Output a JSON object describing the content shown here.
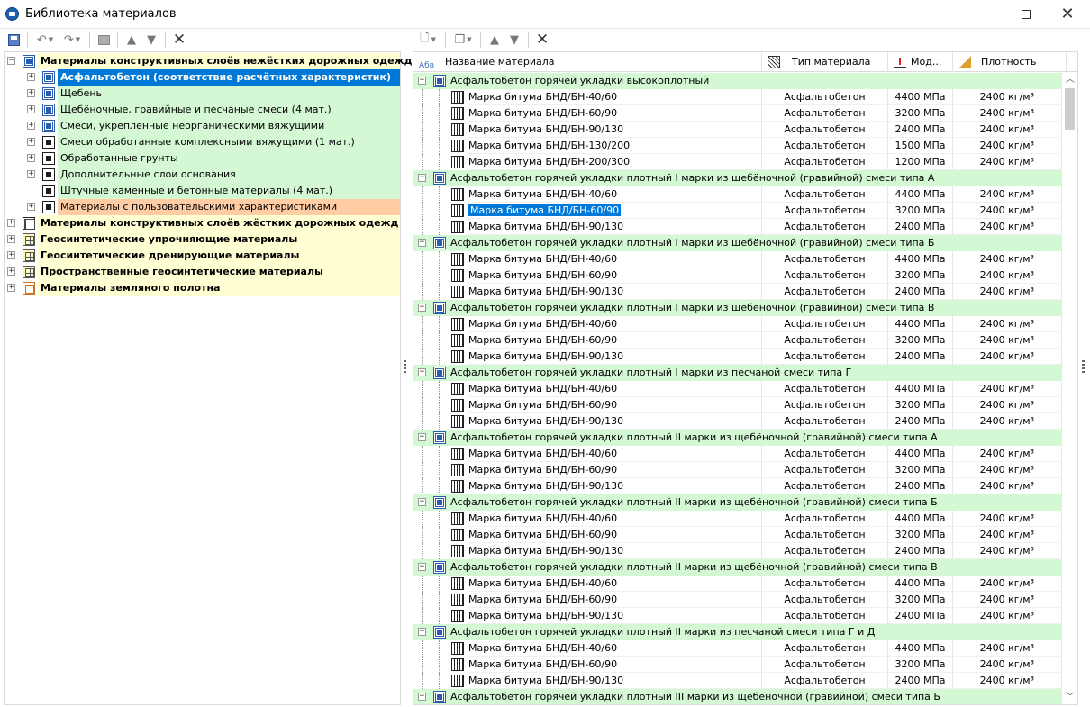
{
  "window": {
    "title": "Библиотека материалов"
  },
  "left_tree": [
    {
      "label": "Материалы конструктивных слоёв нежёстких дорожных одежд",
      "level": 0,
      "bold": true,
      "expanded": true,
      "icon": "blue-square-icon",
      "bg": "yellow"
    },
    {
      "label": "Асфальтобетон (соответствие расчётных характеристик)",
      "level": 1,
      "bold": true,
      "expanded": false,
      "selected": true,
      "icon": "blue-square-icon",
      "bg": "sel"
    },
    {
      "label": "Щебень",
      "level": 1,
      "icon": "blue-square-icon",
      "bg": "green"
    },
    {
      "label": "Щебёночные, гравийные и песчаные смеси (4 мат.)",
      "level": 1,
      "icon": "blue-square-icon",
      "bg": "green"
    },
    {
      "label": "Смеси, укреплённые неорганическими вяжущими",
      "level": 1,
      "icon": "blue-square-icon",
      "bg": "green"
    },
    {
      "label": "Смеси обработанные комплексными вяжущими (1 мат.)",
      "level": 1,
      "icon": "square-icon",
      "bg": "green"
    },
    {
      "label": "Обработанные грунты",
      "level": 1,
      "icon": "square-icon",
      "bg": "green"
    },
    {
      "label": "Дополнительные слои основания",
      "level": 1,
      "icon": "square-icon",
      "bg": "green"
    },
    {
      "label": "Штучные каменные и бетонные материалы (4 мат.)",
      "level": 1,
      "icon": "square-icon",
      "bg": "green",
      "noexp": true
    },
    {
      "label": "Материалы с пользовательскими характеристиками",
      "level": 1,
      "icon": "square-icon",
      "bg": "orange"
    },
    {
      "label": "Материалы конструктивных слоёв жёстких дорожных одежд",
      "level": 0,
      "bold": true,
      "icon": "grid-square-icon",
      "bg": "yellow"
    },
    {
      "label": "Геосинтетические упрочняющие материалы",
      "level": 0,
      "bold": true,
      "icon": "geogrid-icon",
      "bg": "yellow"
    },
    {
      "label": "Геосинтетические дренирующие материалы",
      "level": 0,
      "bold": true,
      "icon": "geogrid-icon",
      "bg": "yellow"
    },
    {
      "label": "Пространственные геосинтетические материалы",
      "level": 0,
      "bold": true,
      "icon": "geogrid-icon",
      "bg": "yellow"
    },
    {
      "label": "Материалы земляного полотна",
      "level": 0,
      "bold": true,
      "icon": "orange-square-icon",
      "bg": "yellow"
    }
  ],
  "grid": {
    "headers": {
      "name": "Название материала",
      "type": "Тип материала",
      "modulus": "Мод...",
      "density": "Плотность"
    },
    "rows": [
      {
        "g": "Асфальтобетон горячей укладки высокоплотный"
      },
      {
        "n": "Марка битума БНД/БН-40/60",
        "t": "Асфальтобетон",
        "m": "4400 МПа",
        "d": "2400 кг/м³"
      },
      {
        "n": "Марка битума БНД/БН-60/90",
        "t": "Асфальтобетон",
        "m": "3200 МПа",
        "d": "2400 кг/м³"
      },
      {
        "n": "Марка битума БНД/БН-90/130",
        "t": "Асфальтобетон",
        "m": "2400 МПа",
        "d": "2400 кг/м³"
      },
      {
        "n": "Марка битума БНД/БН-130/200",
        "t": "Асфальтобетон",
        "m": "1500 МПа",
        "d": "2400 кг/м³"
      },
      {
        "n": "Марка битума БНД/БН-200/300",
        "t": "Асфальтобетон",
        "m": "1200 МПа",
        "d": "2400 кг/м³"
      },
      {
        "g": "Асфальтобетон горячей укладки плотный I марки из щебёночной (гравийной) смеси типа А"
      },
      {
        "n": "Марка битума БНД/БН-40/60",
        "t": "Асфальтобетон",
        "m": "4400 МПа",
        "d": "2400 кг/м³"
      },
      {
        "n": "Марка битума БНД/БН-60/90",
        "t": "Асфальтобетон",
        "m": "3200 МПа",
        "d": "2400 кг/м³",
        "sel": true
      },
      {
        "n": "Марка битума БНД/БН-90/130",
        "t": "Асфальтобетон",
        "m": "2400 МПа",
        "d": "2400 кг/м³"
      },
      {
        "g": "Асфальтобетон горячей укладки плотный I марки из щебёночной (гравийной) смеси типа Б"
      },
      {
        "n": "Марка битума БНД/БН-40/60",
        "t": "Асфальтобетон",
        "m": "4400 МПа",
        "d": "2400 кг/м³"
      },
      {
        "n": "Марка битума БНД/БН-60/90",
        "t": "Асфальтобетон",
        "m": "3200 МПа",
        "d": "2400 кг/м³"
      },
      {
        "n": "Марка битума БНД/БН-90/130",
        "t": "Асфальтобетон",
        "m": "2400 МПа",
        "d": "2400 кг/м³"
      },
      {
        "g": "Асфальтобетон горячей укладки плотный I марки из щебёночной (гравийной) смеси типа В"
      },
      {
        "n": "Марка битума БНД/БН-40/60",
        "t": "Асфальтобетон",
        "m": "4400 МПа",
        "d": "2400 кг/м³"
      },
      {
        "n": "Марка битума БНД/БН-60/90",
        "t": "Асфальтобетон",
        "m": "3200 МПа",
        "d": "2400 кг/м³"
      },
      {
        "n": "Марка битума БНД/БН-90/130",
        "t": "Асфальтобетон",
        "m": "2400 МПа",
        "d": "2400 кг/м³"
      },
      {
        "g": "Асфальтобетон горячей укладки плотный I марки из песчаной смеси типа Г"
      },
      {
        "n": "Марка битума БНД/БН-40/60",
        "t": "Асфальтобетон",
        "m": "4400 МПа",
        "d": "2400 кг/м³"
      },
      {
        "n": "Марка битума БНД/БН-60/90",
        "t": "Асфальтобетон",
        "m": "3200 МПа",
        "d": "2400 кг/м³"
      },
      {
        "n": "Марка битума БНД/БН-90/130",
        "t": "Асфальтобетон",
        "m": "2400 МПа",
        "d": "2400 кг/м³"
      },
      {
        "g": "Асфальтобетон горячей укладки плотный II марки из щебёночной (гравийной) смеси типа А"
      },
      {
        "n": "Марка битума БНД/БН-40/60",
        "t": "Асфальтобетон",
        "m": "4400 МПа",
        "d": "2400 кг/м³"
      },
      {
        "n": "Марка битума БНД/БН-60/90",
        "t": "Асфальтобетон",
        "m": "3200 МПа",
        "d": "2400 кг/м³"
      },
      {
        "n": "Марка битума БНД/БН-90/130",
        "t": "Асфальтобетон",
        "m": "2400 МПа",
        "d": "2400 кг/м³"
      },
      {
        "g": "Асфальтобетон горячей укладки плотный II марки из щебёночной (гравийной) смеси типа Б"
      },
      {
        "n": "Марка битума БНД/БН-40/60",
        "t": "Асфальтобетон",
        "m": "4400 МПа",
        "d": "2400 кг/м³"
      },
      {
        "n": "Марка битума БНД/БН-60/90",
        "t": "Асфальтобетон",
        "m": "3200 МПа",
        "d": "2400 кг/м³"
      },
      {
        "n": "Марка битума БНД/БН-90/130",
        "t": "Асфальтобетон",
        "m": "2400 МПа",
        "d": "2400 кг/м³"
      },
      {
        "g": "Асфальтобетон горячей укладки плотный II марки из щебёночной (гравийной) смеси типа В"
      },
      {
        "n": "Марка битума БНД/БН-40/60",
        "t": "Асфальтобетон",
        "m": "4400 МПа",
        "d": "2400 кг/м³"
      },
      {
        "n": "Марка битума БНД/БН-60/90",
        "t": "Асфальтобетон",
        "m": "3200 МПа",
        "d": "2400 кг/м³"
      },
      {
        "n": "Марка битума БНД/БН-90/130",
        "t": "Асфальтобетон",
        "m": "2400 МПа",
        "d": "2400 кг/м³"
      },
      {
        "g": "Асфальтобетон горячей укладки плотный II марки из песчаной смеси типа Г и Д"
      },
      {
        "n": "Марка битума БНД/БН-40/60",
        "t": "Асфальтобетон",
        "m": "4400 МПа",
        "d": "2400 кг/м³"
      },
      {
        "n": "Марка битума БНД/БН-60/90",
        "t": "Асфальтобетон",
        "m": "3200 МПа",
        "d": "2400 кг/м³"
      },
      {
        "n": "Марка битума БНД/БН-90/130",
        "t": "Асфальтобетон",
        "m": "2400 МПа",
        "d": "2400 кг/м³"
      },
      {
        "g": "Асфальтобетон горячей укладки плотный III марки из щебёночной (гравийной) смеси типа Б"
      }
    ]
  },
  "colors": {
    "yellow": "#ffffd3",
    "green": "#d4f8d4",
    "orange": "#ffcca4",
    "selection": "#0078d7"
  }
}
